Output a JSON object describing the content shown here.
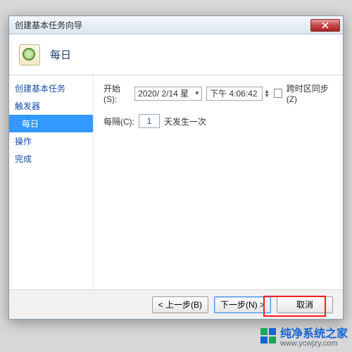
{
  "window": {
    "title": "创建基本任务向导"
  },
  "header": {
    "title": "每日"
  },
  "sidebar": {
    "items": [
      {
        "label": "创建基本任务",
        "selected": false,
        "sub": false
      },
      {
        "label": "触发器",
        "selected": false,
        "sub": false
      },
      {
        "label": "每日",
        "selected": true,
        "sub": true
      },
      {
        "label": "操作",
        "selected": false,
        "sub": false
      },
      {
        "label": "完成",
        "selected": false,
        "sub": false
      }
    ]
  },
  "form": {
    "start_label": "开始(S):",
    "date_value": "2020/ 2/14 星",
    "time_value": "下午  4:06:42",
    "tz_sync_label": "跨时区同步(Z)",
    "tz_sync_checked": false,
    "interval_label": "每隔(C):",
    "interval_value": "1",
    "interval_suffix": "天发生一次"
  },
  "footer": {
    "back": "< 上一步(B)",
    "next": "下一步(N) >",
    "cancel": "取消"
  },
  "watermark": {
    "line1": "纯净系统之家",
    "line2": "www.ycwjzy.com"
  }
}
